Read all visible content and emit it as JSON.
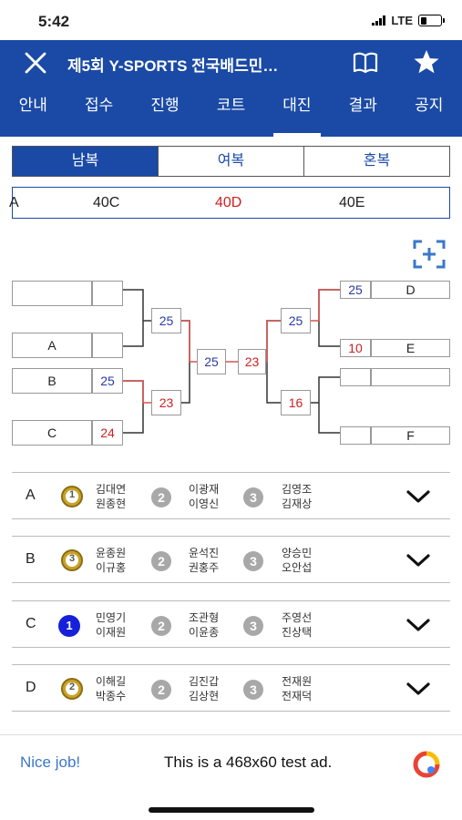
{
  "status": {
    "time": "5:42",
    "network": "LTE"
  },
  "header": {
    "title": "제5회 Y-SPORTS 전국배드민…",
    "tabs": [
      "안내",
      "접수",
      "진행",
      "코트",
      "대진",
      "결과",
      "공지"
    ],
    "active_tab": "대진"
  },
  "segments": [
    "남복",
    "여복",
    "혼복"
  ],
  "active_segment": "남복",
  "courts": {
    "partial": "A",
    "items": [
      "40C",
      "40D",
      "40E"
    ],
    "selected": "40D",
    "selected_color": "#cc2222"
  },
  "bracket": {
    "left_teams": [
      "",
      "A",
      "B",
      "C"
    ],
    "left_scores": [
      "",
      "",
      "25",
      "24"
    ],
    "left_semi": [
      "25",
      "23"
    ],
    "final": [
      "25",
      "23"
    ],
    "right_semi": [
      "25",
      "16"
    ],
    "right_scores": [
      "25",
      "10",
      "",
      ""
    ],
    "right_teams": [
      "D",
      "E",
      "",
      "F"
    ]
  },
  "results": [
    {
      "label": "A",
      "medal": "1",
      "medal_style": "gold",
      "first": [
        "김대연",
        "원종현"
      ],
      "second_badge": "2",
      "second": [
        "이광재",
        "이영신"
      ],
      "third_badge": "3",
      "third": [
        "김영조",
        "김재상"
      ]
    },
    {
      "label": "B",
      "medal": "3",
      "medal_style": "gold",
      "first": [
        "윤종원",
        "이규홍"
      ],
      "second_badge": "2",
      "second": [
        "윤석진",
        "권홍주"
      ],
      "third_badge": "3",
      "third": [
        "양승민",
        "오안섭"
      ]
    },
    {
      "label": "C",
      "medal": "1",
      "medal_style": "solid",
      "first": [
        "민영기",
        "이재원"
      ],
      "second_badge": "2",
      "second": [
        "조관형",
        "이윤종"
      ],
      "third_badge": "3",
      "third": [
        "주영선",
        "진상택"
      ]
    },
    {
      "label": "D",
      "medal": "2",
      "medal_style": "gold",
      "first": [
        "이해길",
        "박종수"
      ],
      "second_badge": "2",
      "second": [
        "김진갑",
        "김상현"
      ],
      "third_badge": "3",
      "third": [
        "전재원",
        "전재덕"
      ]
    }
  ],
  "ad": {
    "nice": "Nice job!",
    "text": "This is a 468x60 test ad."
  },
  "colors": {
    "primary": "#1a4aa5",
    "score_blue": "#2a3aa8",
    "score_red": "#cc2222"
  }
}
